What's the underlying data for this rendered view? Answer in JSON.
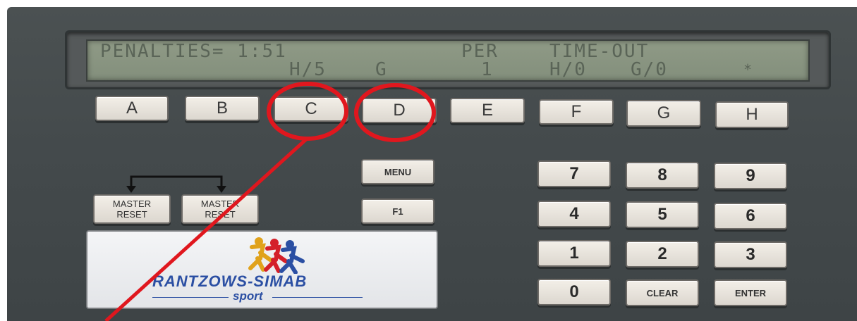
{
  "display": {
    "line1_left": "PENALTIES= 1:51",
    "line1_per": "PER",
    "line1_right": "TIME-OUT",
    "line2_home": "H/5",
    "line2_guest": "G",
    "line2_per_value": "1",
    "line2_to_home": "H/0",
    "line2_to_guest": "G/0",
    "line2_end": "*"
  },
  "function_keys": [
    "A",
    "B",
    "C",
    "D",
    "E",
    "F",
    "G",
    "H"
  ],
  "master_reset_label_1": "MASTER",
  "master_reset_label_2": "RESET",
  "menu_label": "MENU",
  "f1_label": "F1",
  "keypad": {
    "k7": "7",
    "k8": "8",
    "k9": "9",
    "k4": "4",
    "k5": "5",
    "k6": "6",
    "k1": "1",
    "k2": "2",
    "k3": "3",
    "k0": "0",
    "clear": "CLEAR",
    "enter": "ENTER"
  },
  "logo": {
    "brand": "RANTZOWS-SIMAB",
    "sub": "sport"
  },
  "colors": {
    "panel": "#474d4f",
    "lcd": "#8a9582",
    "annotation_red": "#e0171e",
    "logo_blue": "#2b4fa3"
  }
}
